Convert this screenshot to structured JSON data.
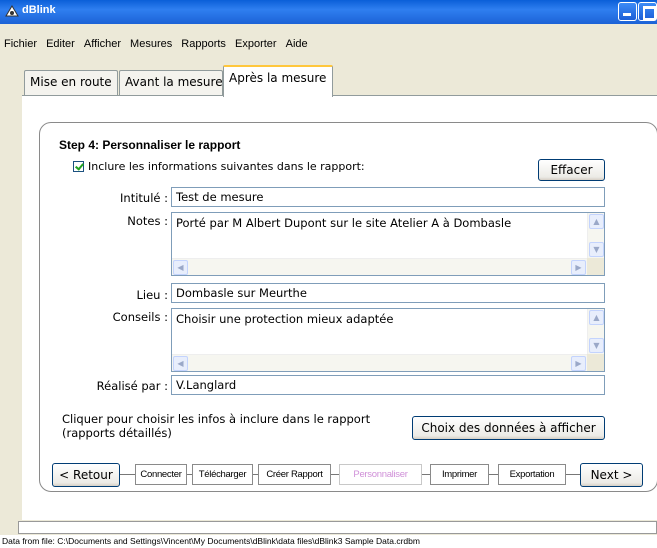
{
  "window": {
    "title": "dBlink"
  },
  "menu": [
    "Fichier",
    "Editer",
    "Afficher",
    "Mesures",
    "Rapports",
    "Exporter",
    "Aide"
  ],
  "tabs": [
    "Mise en route",
    "Avant la mesure",
    "Après la mesure"
  ],
  "step": {
    "title": "Step 4: Personnaliser le rapport",
    "include_label": "Inclure les informations suivantes dans le rapport:",
    "include_checked": true,
    "clear_button": "Effacer"
  },
  "fields": {
    "intitule_label": "Intitulé :",
    "intitule_value": "Test de mesure",
    "notes_label": "Notes :",
    "notes_value": "Porté par M Albert Dupont sur le site Atelier A à Dombasle",
    "lieu_label": "Lieu :",
    "lieu_value": "Dombasle sur Meurthe",
    "conseils_label": "Conseils :",
    "conseils_value": "Choisir une protection mieux adaptée",
    "realise_label": "Réalisé par :",
    "realise_value": "V.Langlard"
  },
  "hint": {
    "line1": "Cliquer pour choisir les infos à inclure dans le rapport",
    "line2": "(rapports détaillés)",
    "choose_button": "Choix des données à afficher"
  },
  "wizard": {
    "back": "< Retour",
    "next": "Next >",
    "steps": [
      "Connecter",
      "Télécharger",
      "Créer Rapport",
      "Personnaliser",
      "Imprimer",
      "Exportation"
    ],
    "current_step": "Personnaliser"
  },
  "status": "Data from file: C:\\Documents and Settings\\Vincent\\My Documents\\dBlink\\data files\\dBlink3 Sample Data.crdbm"
}
